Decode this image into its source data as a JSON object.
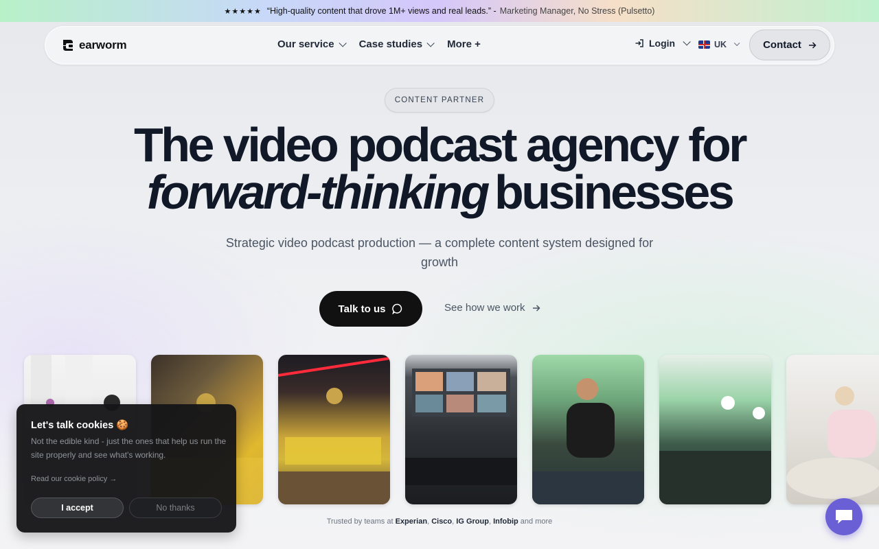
{
  "banner": {
    "stars": "★★★★★",
    "quote": "“High-quality content that drove 1M+ views and real leads.” -",
    "author": "Marketing Manager, No Stress (Pulsetto)"
  },
  "nav": {
    "brand": "earworm",
    "menu": [
      {
        "label": "Our service"
      },
      {
        "label": "Case studies"
      },
      {
        "label": "More +"
      }
    ],
    "login": "Login",
    "locale": "UK",
    "contact": "Contact"
  },
  "hero": {
    "pill": "CONTENT PARTNER",
    "title_line1": "The video podcast agency for",
    "title_emphasis": "forward-thinking",
    "title_rest": "businesses",
    "subtitle": "Strategic video podcast production — a complete content system designed for growth",
    "cta_primary": "Talk to us",
    "cta_secondary": "See how we work"
  },
  "trusted": {
    "prefix": "Trusted by teams at",
    "companies": [
      "Experian",
      "Cisco",
      "IG Group",
      "Infobip"
    ],
    "suffix": "and more"
  },
  "cookie": {
    "title": "Let's talk cookies 🍪",
    "body": "Not the edible kind - just the ones that help us run the site properly and see what's working.",
    "link": "Read our cookie policy →",
    "accept": "I accept",
    "decline": "No thanks"
  },
  "colors": {
    "accent": "#111111",
    "chat": "#6b5fd6"
  },
  "icons": {
    "login": "login-icon",
    "contact_arrow": "arrow-right-icon",
    "chat": "chat-icon",
    "flag": "uk-flag-icon"
  }
}
